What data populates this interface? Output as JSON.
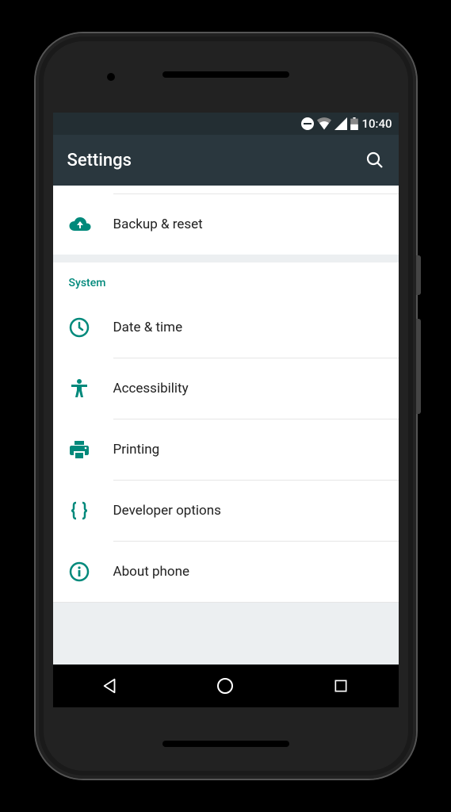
{
  "status_bar": {
    "time": "10:40"
  },
  "app_bar": {
    "title": "Settings"
  },
  "top_item": {
    "label": "Backup & reset"
  },
  "section": {
    "header": "System",
    "items": [
      {
        "label": "Date & time"
      },
      {
        "label": "Accessibility"
      },
      {
        "label": "Printing"
      },
      {
        "label": "Developer options"
      },
      {
        "label": "About phone"
      }
    ]
  }
}
